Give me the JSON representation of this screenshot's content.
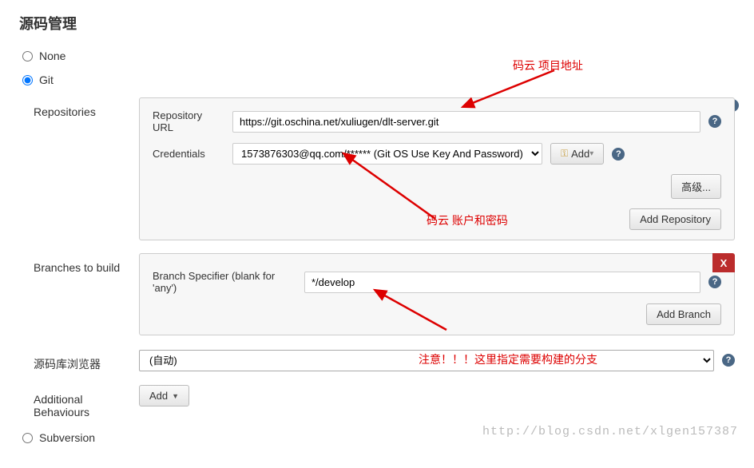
{
  "title": "源码管理",
  "scm_options": {
    "none": "None",
    "git": "Git",
    "subversion": "Subversion"
  },
  "repositories": {
    "section_label": "Repositories",
    "repo_url_label": "Repository URL",
    "repo_url_value": "https://git.oschina.net/xuliugen/dlt-server.git",
    "credentials_label": "Credentials",
    "credentials_value": "1573876303@qq.com/****** (Git OS Use Key And Password)",
    "add_button": "Add",
    "advanced_button": "高级...",
    "add_repository_button": "Add Repository"
  },
  "branches": {
    "section_label": "Branches to build",
    "specifier_label": "Branch Specifier (blank for 'any')",
    "specifier_value": "*/develop",
    "add_branch_button": "Add Branch",
    "delete_label": "X"
  },
  "repo_browser": {
    "section_label": "源码库浏览器",
    "value": "(自动)"
  },
  "additional_behaviours": {
    "section_label": "Additional Behaviours",
    "add_button": "Add"
  },
  "annotations": {
    "proj_addr": "码云 项目地址",
    "account_pwd": "码云 账户和密码",
    "branch_note": "注意！！！这里指定需要构建的分支"
  },
  "watermark": "http://blog.csdn.net/xlgen157387"
}
